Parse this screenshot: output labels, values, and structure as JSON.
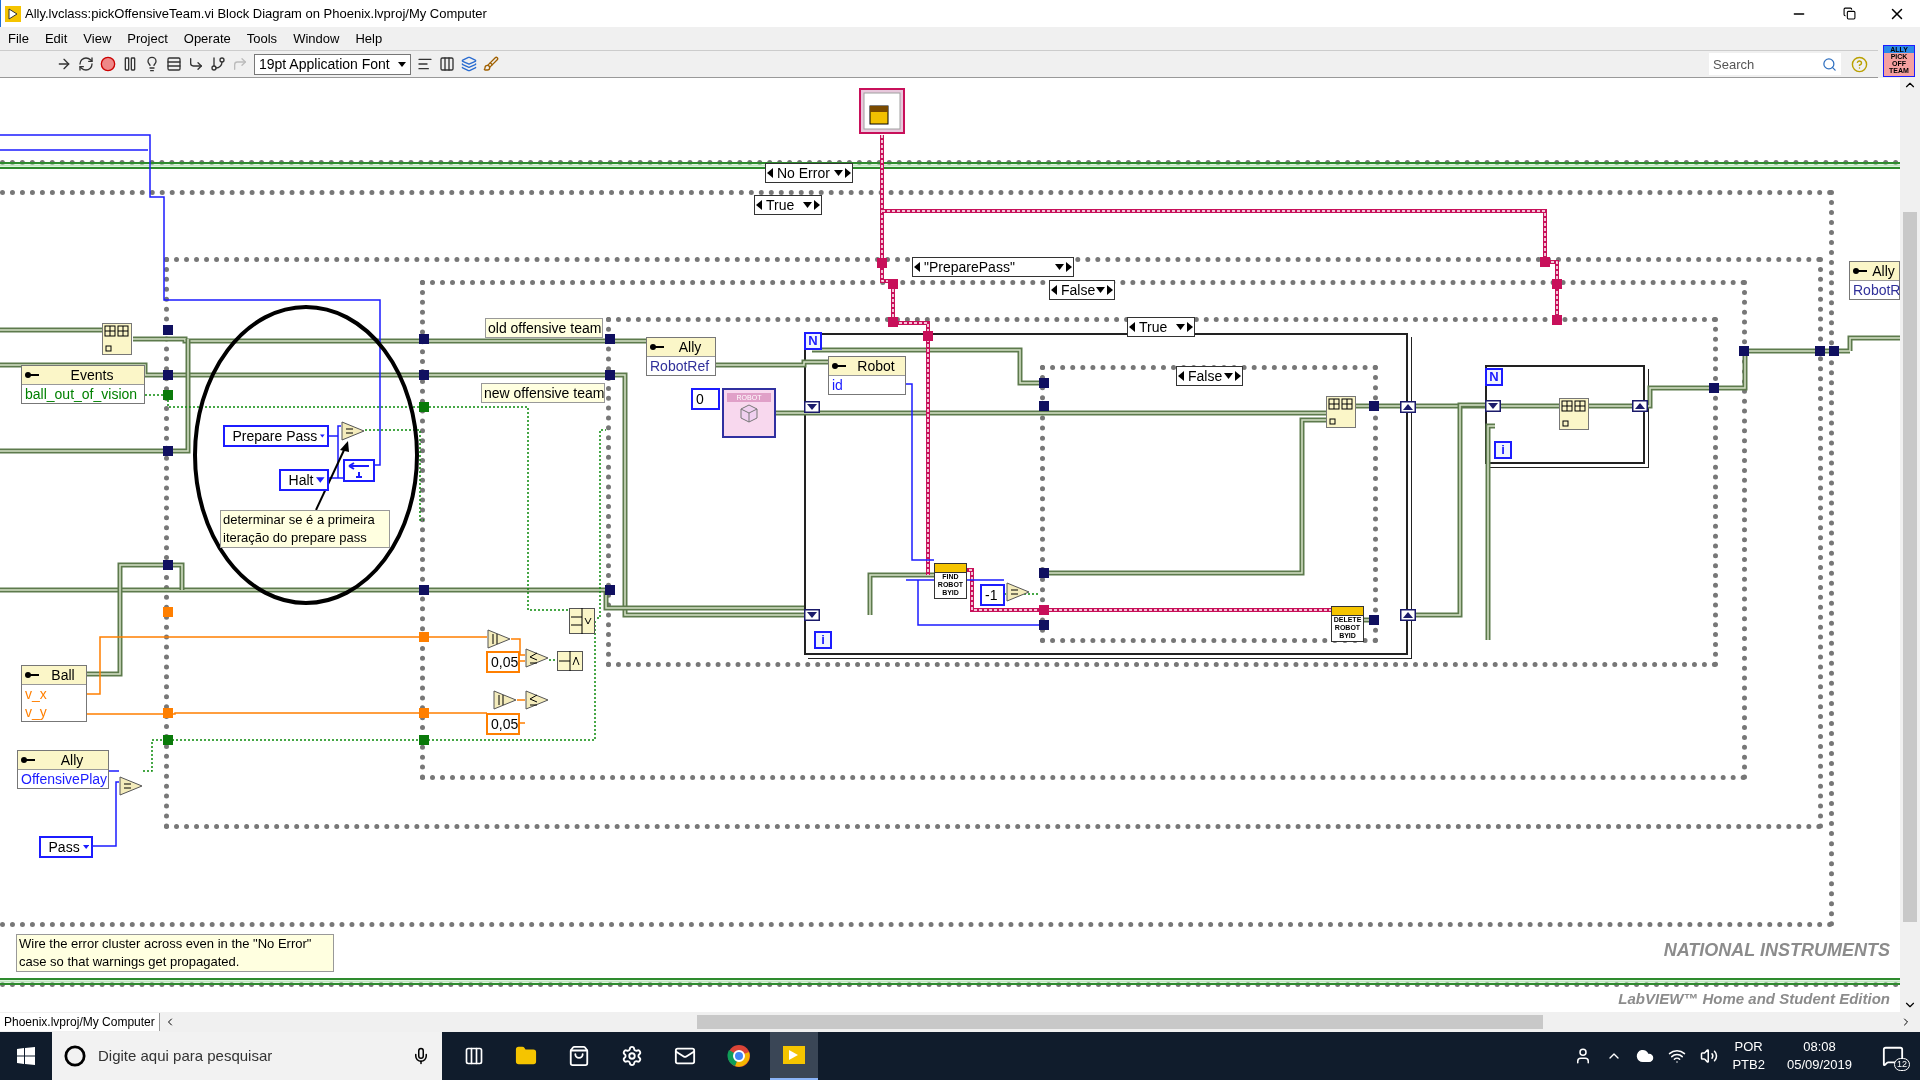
{
  "window": {
    "title": "Ally.lvclass:pickOffensiveTeam.vi Block Diagram on Phoenix.lvproj/My Computer"
  },
  "menu": [
    "File",
    "Edit",
    "View",
    "Project",
    "Operate",
    "Tools",
    "Window",
    "Help"
  ],
  "toolbar": {
    "font": "19pt Application Font",
    "search": {
      "placeholder": "Search"
    }
  },
  "vi_icon": {
    "header": "ALLY",
    "body": "PICK OFF TEAM"
  },
  "diagram": {
    "selectors": [
      {
        "label": "No Error"
      },
      {
        "label": "True"
      },
      {
        "label": "\"PreparePass\""
      },
      {
        "label": "False"
      },
      {
        "label": "True"
      },
      {
        "label": "False"
      }
    ],
    "clusters": [
      {
        "name": "Events",
        "fields": [
          {
            "name": "ball_out_of_vision",
            "kind": "boolean"
          }
        ]
      },
      {
        "name": "Ball",
        "fields": [
          {
            "name": "v_x",
            "kind": "number"
          },
          {
            "name": "v_y",
            "kind": "number"
          }
        ]
      },
      {
        "name": "Ally",
        "fields": [
          {
            "name": "OffensivePlay",
            "kind": "enum"
          }
        ]
      },
      {
        "name": "Ally",
        "fields": [
          {
            "name": "RobotRef",
            "kind": "reference"
          }
        ]
      },
      {
        "name": "Robot",
        "fields": [
          {
            "name": "id",
            "kind": "enum"
          }
        ]
      },
      {
        "name": "Ally",
        "fields": [
          {
            "name": "RobotR",
            "kind": "reference"
          }
        ]
      }
    ],
    "enums": [
      "Prepare Pass",
      "Halt",
      "Pass"
    ],
    "constants": [
      {
        "value": "0",
        "kind": "integer"
      },
      {
        "value": "0,05",
        "kind": "number"
      },
      {
        "value": "0,05",
        "kind": "number"
      },
      {
        "value": "-1",
        "kind": "integer"
      }
    ],
    "labels": [
      "old offensive team",
      "new offensive team"
    ],
    "subvis": [
      "FIND ROBOT BYID",
      "DELETE ROBOT BYID"
    ],
    "class_constant": "ROBOT",
    "loops": [
      {
        "count": "N",
        "index": "i"
      },
      {
        "count": "N",
        "index": "i"
      }
    ],
    "comments": [
      "determinar se é a primeira iteração do prepare pass",
      "Wire the error cluster across even in the \"No Error\" case so that warnings get propagated."
    ]
  },
  "edition_mark": {
    "brand": "NATIONAL INSTRUMENTS",
    "edition": "LabVIEW™ Home and Student Edition"
  },
  "project_tab": "Phoenix.lvproj/My Computer",
  "taskbar": {
    "search": {
      "placeholder": "Digite aqui para pesquisar"
    },
    "language": "POR",
    "layout": "PTB2",
    "time": "08:08",
    "date": "05/09/2019",
    "notifications": "12"
  }
}
